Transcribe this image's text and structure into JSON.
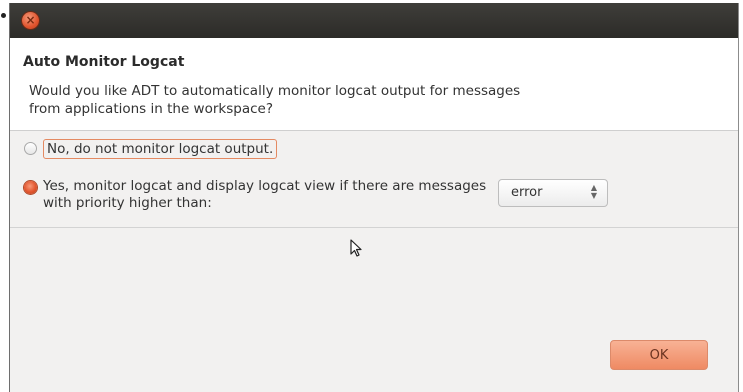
{
  "dialog": {
    "title": "Auto Monitor Logcat",
    "message": "Would you like ADT to automatically monitor logcat output for messages from applications in the workspace?",
    "options": [
      {
        "label": "No, do not monitor logcat output.",
        "selected": false
      },
      {
        "label": "Yes, monitor logcat and display logcat view if there are messages with priority higher than:",
        "selected": true
      }
    ],
    "priority_select": {
      "value": "error"
    },
    "ok_label": "OK"
  },
  "colors": {
    "accent": "#e2552e",
    "titlebar": "#2c2b28"
  },
  "icons": {
    "close": "close-icon",
    "cursor": "mouse-pointer-icon"
  }
}
